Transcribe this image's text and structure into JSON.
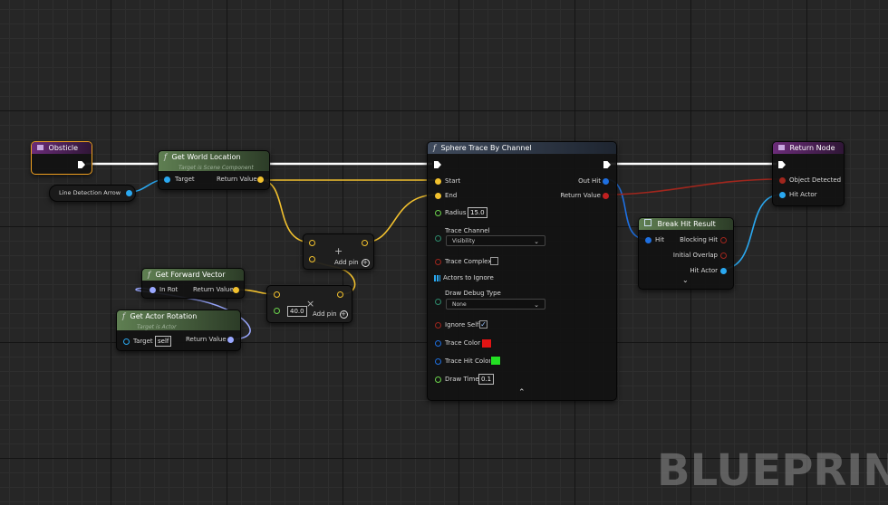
{
  "watermark": "BLUEPRINT",
  "colors": {
    "vector_pin": "#f2c12e",
    "object_pin": "#2aa8f0",
    "struct_pin": "#1e6fe0",
    "bool_pin": "#a0261d",
    "float_pin": "#6cd44c",
    "rotator_pin": "#9aa8ff",
    "exec_wire": "#ffffff",
    "trace_color": "#e21414",
    "trace_hit_color": "#23e023"
  },
  "nodes": {
    "obsticle": {
      "title": "Obsticle"
    },
    "line_detection": {
      "label": "Line Detection Arrow"
    },
    "get_world_location": {
      "title": "Get World Location",
      "subtitle": "Target is Scene Component",
      "target": "Target",
      "return_value": "Return Value"
    },
    "add_vec_upper": {
      "add_pin": "Add pin",
      "plus": "+"
    },
    "add_vec_lower": {
      "value": "40.0",
      "add_pin": "Add pin",
      "times": "×"
    },
    "get_forward_vector": {
      "title": "Get Forward Vector",
      "in_rot": "In Rot",
      "return_value": "Return Value"
    },
    "get_actor_rotation": {
      "title": "Get Actor Rotation",
      "subtitle": "Target is Actor",
      "target": "Target",
      "self": "self",
      "return_value": "Return Value"
    },
    "sphere_trace": {
      "title": "Sphere Trace By Channel",
      "start": "Start",
      "end": "End",
      "radius": "Radius",
      "radius_value": "15.0",
      "trace_channel": "Trace Channel",
      "trace_channel_value": "Visibility",
      "trace_complex": "Trace Complex",
      "actors_to_ignore": "Actors to Ignore",
      "draw_debug_type": "Draw Debug Type",
      "draw_debug_value": "None",
      "ignore_self": "Ignore Self",
      "trace_color": "Trace Color",
      "trace_hit_color": "Trace Hit Color",
      "draw_time": "Draw Time",
      "draw_time_value": "0.1",
      "out_hit": "Out Hit",
      "return_value": "Return Value",
      "checkmark": "✓",
      "collapse": "⌃"
    },
    "break_hit_result": {
      "title": "Break Hit Result",
      "hit": "Hit",
      "blocking_hit": "Blocking Hit",
      "initial_overlap": "Initial Overlap",
      "hit_actor": "Hit Actor",
      "expand": "⌄"
    },
    "return_node": {
      "title": "Return Node",
      "object_detected": "Object Detected",
      "hit_actor": "Hit Actor"
    }
  },
  "glyphs": {
    "function": "f",
    "dropdown": "⌄",
    "add": "+"
  }
}
